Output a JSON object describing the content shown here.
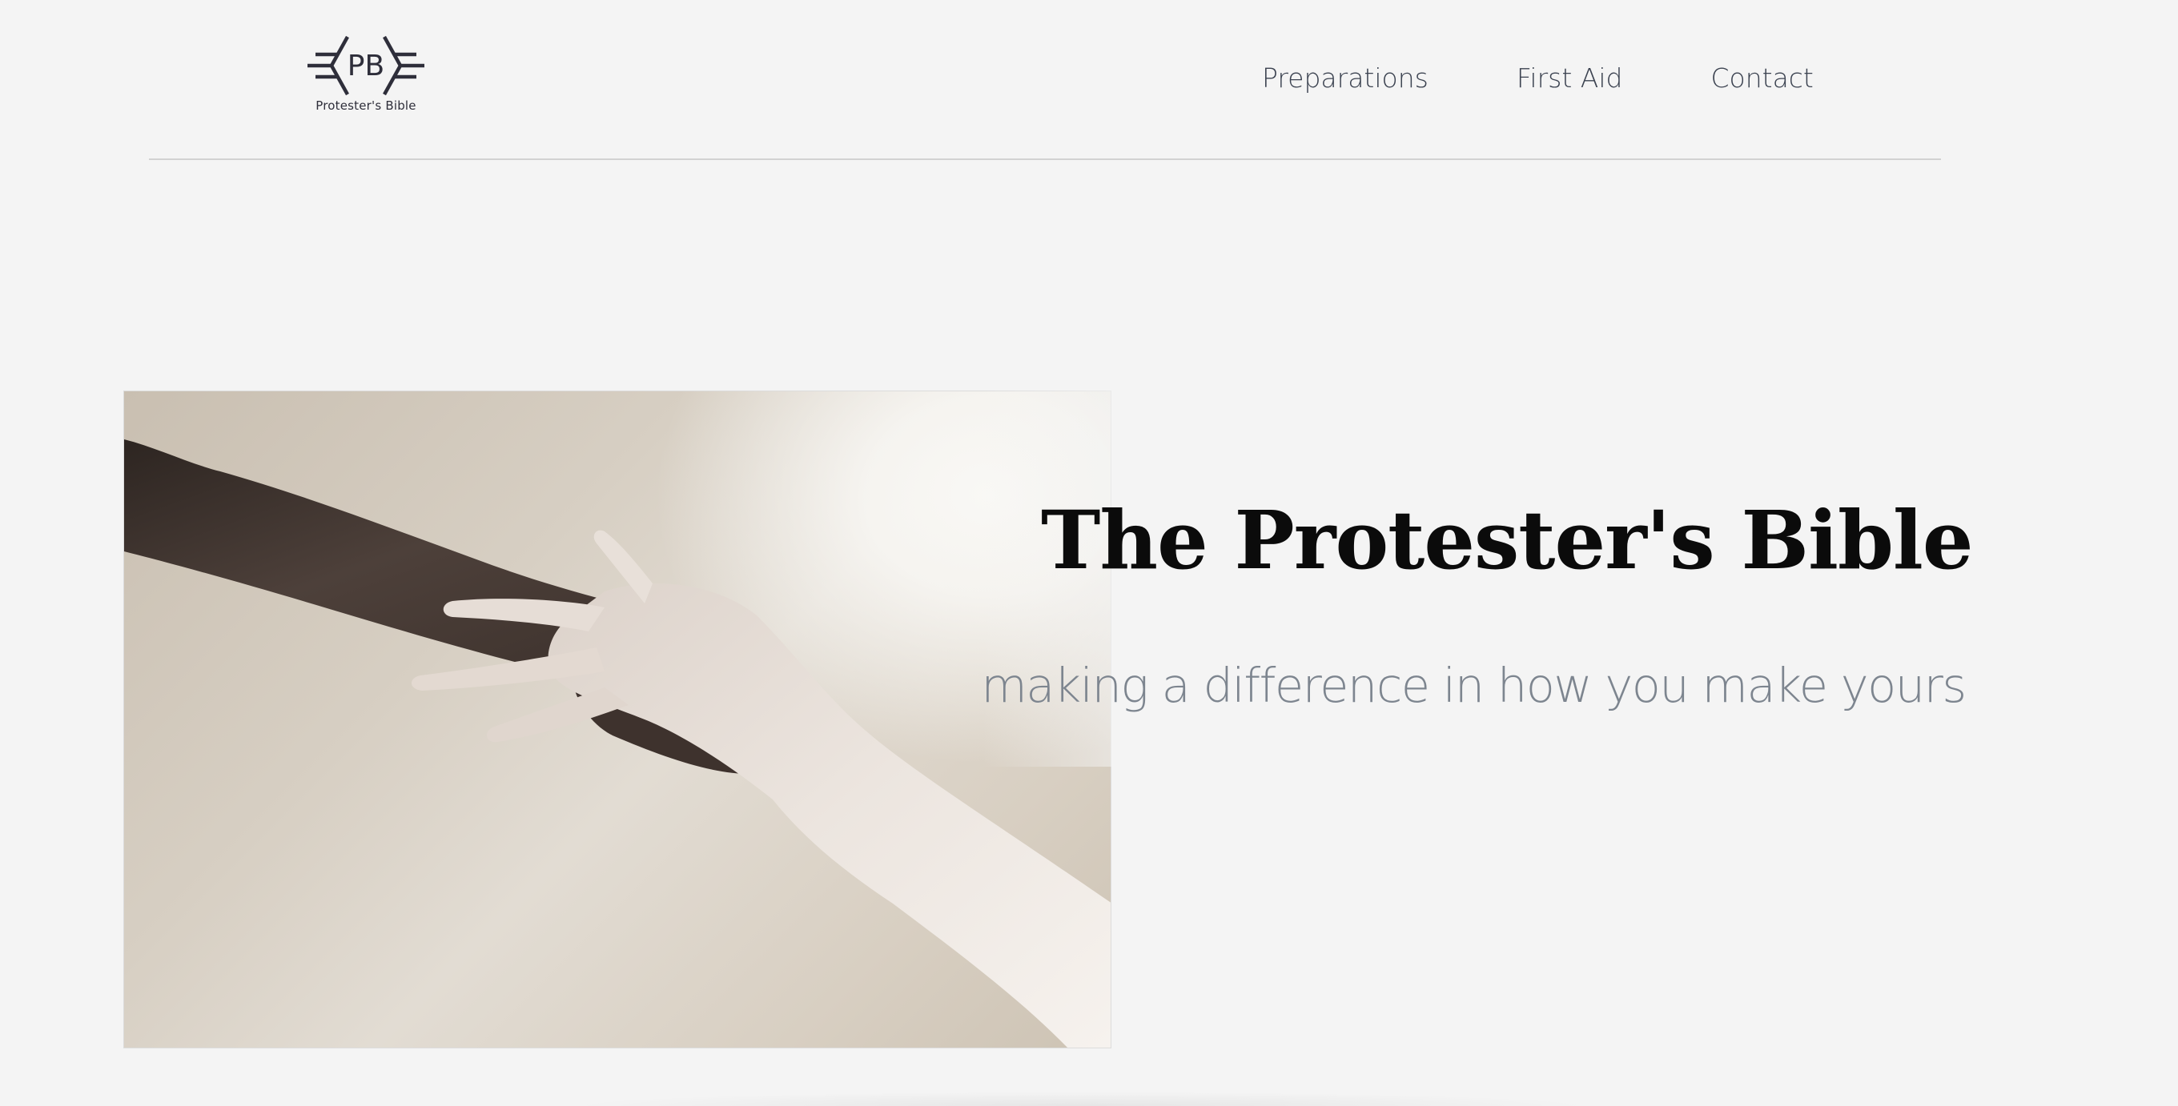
{
  "header": {
    "logo": {
      "monogram": "PB",
      "caption": "Protester's Bible",
      "icon": "pb-logo-icon"
    },
    "nav": [
      {
        "label": "Preparations"
      },
      {
        "label": "First Aid"
      },
      {
        "label": "Contact"
      }
    ]
  },
  "hero": {
    "title": "The Protester's Bible",
    "subtitle": "making a difference in how you make yours",
    "image_subject": "reaching-hands-photo"
  },
  "colors": {
    "background": "#f4f4f4",
    "nav_text": "#3b4250",
    "title": "#0b0b0b",
    "subtitle": "#7d858f",
    "logo": "#2e2e3a",
    "divider": "#d2d2d2"
  }
}
